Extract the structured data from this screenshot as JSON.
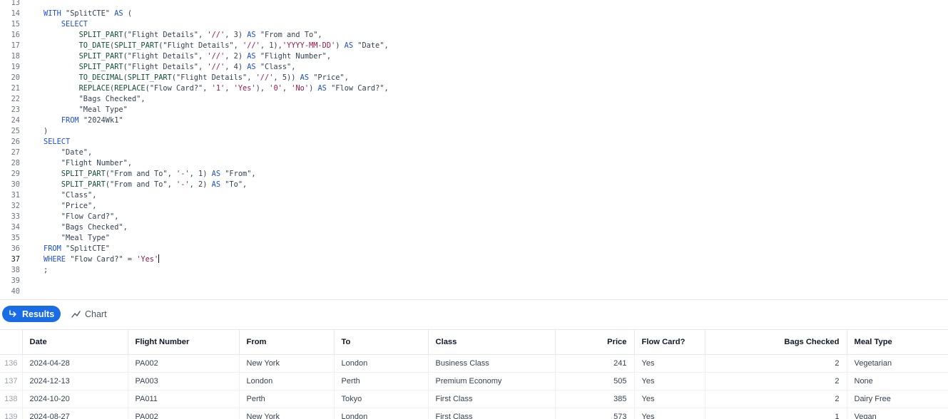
{
  "editor": {
    "lines": [
      {
        "n": "13",
        "tokens": []
      },
      {
        "n": "14",
        "tokens": [
          [
            "kw",
            "WITH "
          ],
          [
            "id",
            "\"SplitCTE\" "
          ],
          [
            "kw",
            "AS "
          ],
          [
            "id",
            "("
          ]
        ]
      },
      {
        "n": "15",
        "tokens": [
          [
            "id",
            "    "
          ],
          [
            "kw",
            "SELECT"
          ]
        ]
      },
      {
        "n": "16",
        "tokens": [
          [
            "id",
            "        "
          ],
          [
            "fn",
            "SPLIT_PART"
          ],
          [
            "id",
            "(\"Flight Details\", "
          ],
          [
            "str",
            "'//'"
          ],
          [
            "id",
            ", 3) "
          ],
          [
            "kw",
            "AS "
          ],
          [
            "id",
            "\"From and To\","
          ]
        ]
      },
      {
        "n": "17",
        "tokens": [
          [
            "id",
            "        "
          ],
          [
            "fn",
            "TO_DATE"
          ],
          [
            "id",
            "("
          ],
          [
            "fn",
            "SPLIT_PART"
          ],
          [
            "id",
            "(\"Flight Details\", "
          ],
          [
            "str",
            "'//'"
          ],
          [
            "id",
            ", 1),"
          ],
          [
            "str",
            "'YYYY-MM-DD'"
          ],
          [
            "id",
            ") "
          ],
          [
            "kw",
            "AS "
          ],
          [
            "id",
            "\"Date\","
          ]
        ]
      },
      {
        "n": "18",
        "tokens": [
          [
            "id",
            "        "
          ],
          [
            "fn",
            "SPLIT_PART"
          ],
          [
            "id",
            "(\"Flight Details\", "
          ],
          [
            "str",
            "'//'"
          ],
          [
            "id",
            ", 2) "
          ],
          [
            "kw",
            "AS "
          ],
          [
            "id",
            "\"Flight Number\","
          ]
        ]
      },
      {
        "n": "19",
        "tokens": [
          [
            "id",
            "        "
          ],
          [
            "fn",
            "SPLIT_PART"
          ],
          [
            "id",
            "(\"Flight Details\", "
          ],
          [
            "str",
            "'//'"
          ],
          [
            "id",
            ", 4) "
          ],
          [
            "kw",
            "AS "
          ],
          [
            "id",
            "\"Class\","
          ]
        ]
      },
      {
        "n": "20",
        "tokens": [
          [
            "id",
            "        "
          ],
          [
            "fn",
            "TO_DECIMAL"
          ],
          [
            "id",
            "("
          ],
          [
            "fn",
            "SPLIT_PART"
          ],
          [
            "id",
            "(\"Flight Details\", "
          ],
          [
            "str",
            "'//'"
          ],
          [
            "id",
            ", 5)) "
          ],
          [
            "kw",
            "AS "
          ],
          [
            "id",
            "\"Price\","
          ]
        ]
      },
      {
        "n": "21",
        "tokens": [
          [
            "id",
            "        "
          ],
          [
            "fn",
            "REPLACE"
          ],
          [
            "id",
            "("
          ],
          [
            "fn",
            "REPLACE"
          ],
          [
            "id",
            "(\"Flow Card?\", "
          ],
          [
            "str",
            "'1'"
          ],
          [
            "id",
            ", "
          ],
          [
            "str",
            "'Yes'"
          ],
          [
            "id",
            "), "
          ],
          [
            "str",
            "'0'"
          ],
          [
            "id",
            ", "
          ],
          [
            "str",
            "'No'"
          ],
          [
            "id",
            ") "
          ],
          [
            "kw",
            "AS "
          ],
          [
            "id",
            "\"Flow Card?\","
          ]
        ]
      },
      {
        "n": "22",
        "tokens": [
          [
            "id",
            "        \"Bags Checked\","
          ]
        ]
      },
      {
        "n": "23",
        "tokens": [
          [
            "id",
            "        \"Meal Type\""
          ]
        ]
      },
      {
        "n": "24",
        "tokens": [
          [
            "id",
            "    "
          ],
          [
            "kw",
            "FROM "
          ],
          [
            "id",
            "\"2024Wk1\""
          ]
        ]
      },
      {
        "n": "25",
        "tokens": [
          [
            "id",
            ")"
          ]
        ]
      },
      {
        "n": "26",
        "tokens": [
          [
            "kw",
            "SELECT"
          ]
        ]
      },
      {
        "n": "27",
        "tokens": [
          [
            "id",
            "    \"Date\","
          ]
        ]
      },
      {
        "n": "28",
        "tokens": [
          [
            "id",
            "    \"Flight Number\","
          ]
        ]
      },
      {
        "n": "29",
        "tokens": [
          [
            "id",
            "    "
          ],
          [
            "fn",
            "SPLIT_PART"
          ],
          [
            "id",
            "(\"From and To\", "
          ],
          [
            "str",
            "'-'"
          ],
          [
            "id",
            ", 1) "
          ],
          [
            "kw",
            "AS "
          ],
          [
            "id",
            "\"From\","
          ]
        ]
      },
      {
        "n": "30",
        "tokens": [
          [
            "id",
            "    "
          ],
          [
            "fn",
            "SPLIT_PART"
          ],
          [
            "id",
            "(\"From and To\", "
          ],
          [
            "str",
            "'-'"
          ],
          [
            "id",
            ", 2) "
          ],
          [
            "kw",
            "AS "
          ],
          [
            "id",
            "\"To\","
          ]
        ]
      },
      {
        "n": "31",
        "tokens": [
          [
            "id",
            "    \"Class\","
          ]
        ]
      },
      {
        "n": "32",
        "tokens": [
          [
            "id",
            "    \"Price\","
          ]
        ]
      },
      {
        "n": "33",
        "tokens": [
          [
            "id",
            "    \"Flow Card?\","
          ]
        ]
      },
      {
        "n": "34",
        "tokens": [
          [
            "id",
            "    \"Bags Checked\","
          ]
        ]
      },
      {
        "n": "35",
        "tokens": [
          [
            "id",
            "    \"Meal Type\""
          ]
        ]
      },
      {
        "n": "36",
        "tokens": [
          [
            "kw",
            "FROM "
          ],
          [
            "id",
            "\"SplitCTE\""
          ]
        ]
      },
      {
        "n": "37",
        "active": true,
        "cursor": true,
        "tokens": [
          [
            "kw",
            "WHERE "
          ],
          [
            "id",
            "\"Flow Card?\" = "
          ],
          [
            "str",
            "'Yes'"
          ]
        ]
      },
      {
        "n": "38",
        "tokens": [
          [
            "id",
            ";"
          ]
        ]
      },
      {
        "n": "39",
        "tokens": []
      },
      {
        "n": "40",
        "tokens": []
      }
    ]
  },
  "toolbar": {
    "results_label": "Results",
    "chart_label": "Chart",
    "results_icon": "return-arrow-icon",
    "chart_icon": "line-chart-icon"
  },
  "results": {
    "columns": [
      "Date",
      "Flight Number",
      "From",
      "To",
      "Class",
      "Price",
      "Flow Card?",
      "Bags Checked",
      "Meal Type"
    ],
    "rows": [
      {
        "num": "136",
        "cells": [
          "2024-04-28",
          "PA002",
          "New York",
          "London",
          "Business Class",
          "241",
          "Yes",
          "2",
          "Vegetarian"
        ]
      },
      {
        "num": "137",
        "cells": [
          "2024-12-13",
          "PA003",
          "London",
          "Perth",
          "Premium Economy",
          "505",
          "Yes",
          "2",
          "None"
        ]
      },
      {
        "num": "138",
        "cells": [
          "2024-10-20",
          "PA011",
          "Perth",
          "Tokyo",
          "First Class",
          "385",
          "Yes",
          "2",
          "Dairy Free"
        ]
      },
      {
        "num": "139",
        "cells": [
          "2024-08-27",
          "PA002",
          "New York",
          "London",
          "First Class",
          "573",
          "Yes",
          "1",
          "Vegan"
        ]
      }
    ]
  },
  "colors": {
    "accent": "#1a6ce6",
    "keyword": "#1d4ed8",
    "string": "#9d174d",
    "function": "#0f5132"
  }
}
